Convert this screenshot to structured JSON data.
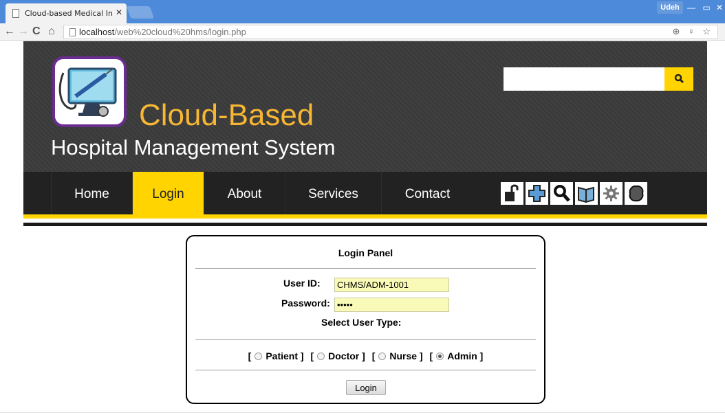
{
  "browser": {
    "tab_title": "Cloud-based Medical Infor",
    "tab_close": "✕",
    "user_badge": "Udeh",
    "window_min": "—",
    "window_max": "▭",
    "window_close": "✕",
    "url_host": "localhost",
    "url_path": "/web%20cloud%20hms/login.php",
    "nav_icons": {
      "back": "←",
      "forward": "→",
      "reload": "C",
      "home": "⌂"
    },
    "url_right_icons": "⊕ ♀ ☆"
  },
  "header": {
    "brand_title": "Cloud-Based",
    "brand_subtitle": "Hospital Management System",
    "search_value": "",
    "logo_icon": "monitor-stethoscope-syringe"
  },
  "nav": {
    "items": [
      {
        "label": "Home",
        "active": false
      },
      {
        "label": "Login",
        "active": true
      },
      {
        "label": "About",
        "active": false
      },
      {
        "label": "Services",
        "active": false
      },
      {
        "label": "Contact",
        "active": false
      }
    ],
    "icons": [
      "unlock-icon",
      "medical-cross-icon",
      "search-icon",
      "book-icon",
      "gear-icon",
      "brain-icon"
    ]
  },
  "login_panel": {
    "title": "Login Panel",
    "user_id_label": "User ID:",
    "user_id_value": "CHMS/ADM-1001",
    "password_label": "Password:",
    "password_value": "•••••",
    "user_type_label": "Select User Type:",
    "user_types": [
      {
        "label": "Patient",
        "checked": false
      },
      {
        "label": "Doctor",
        "checked": false
      },
      {
        "label": "Nurse",
        "checked": false
      },
      {
        "label": "Admin",
        "checked": true
      }
    ],
    "bracket_open": "[",
    "bracket_close": "]",
    "submit_label": "Login"
  },
  "colors": {
    "accent_yellow": "#ffd400",
    "brand_orange": "#f7b633",
    "header_bg": "#3a3a3a",
    "nav_bg": "#222222",
    "logo_border": "#6a2c91",
    "input_bg": "#fafab8"
  }
}
